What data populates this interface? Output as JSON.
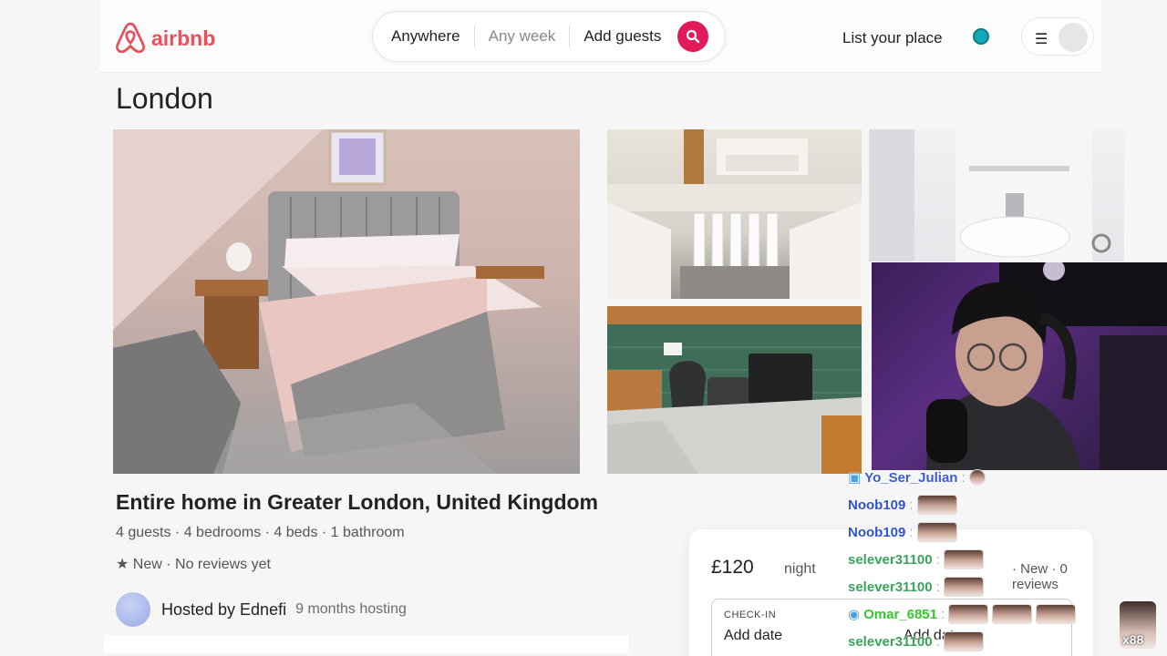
{
  "header": {
    "logo_text": "airbnb",
    "search": {
      "anywhere": "Anywhere",
      "any_week": "Any week",
      "add_guests": "Add guests"
    },
    "list_your_place": "List your place"
  },
  "listing": {
    "location_title": "London",
    "title": "Entire home in Greater London, United Kingdom",
    "specs": "4 guests · 4 bedrooms · 4 beds · 1 bathroom",
    "rating": "★ New · No reviews yet",
    "host_name": "Hosted by Ednefi",
    "host_duration": "9 months hosting"
  },
  "booking": {
    "price": "£120",
    "unit": "night",
    "reviews": "· New · 0 reviews",
    "checkin_label": "CHECK-IN",
    "checkin_value": "Add date",
    "checkout_value": "Add date"
  },
  "chat": {
    "messages": [
      {
        "user": "Yo_Ser_Julian",
        "color": "#3a5bd9"
      },
      {
        "user": "Noob109",
        "color": "#2f53d6"
      },
      {
        "user": "Noob109",
        "color": "#2f53d6"
      },
      {
        "user": "selever31100",
        "color": "#3aa55a"
      },
      {
        "user": "selever31100",
        "color": "#3aa55a"
      },
      {
        "user": "Omar_6851",
        "color": "#37c72f"
      },
      {
        "user": "selever31100",
        "color": "#3aa55a"
      }
    ],
    "corner_count": "x88"
  },
  "colors": {
    "brand": "#e8525d",
    "search_button": "#e21c5a"
  }
}
